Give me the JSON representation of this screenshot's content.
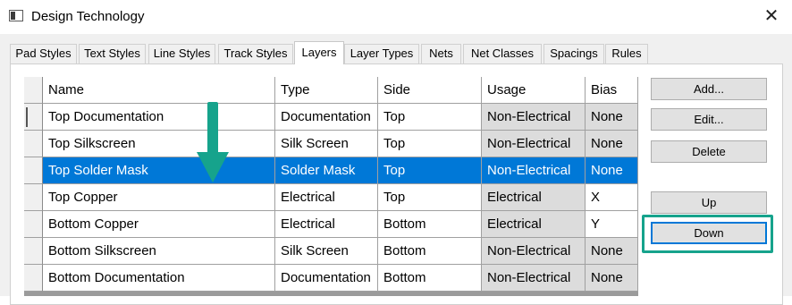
{
  "window": {
    "title": "Design Technology",
    "close_glyph": "✕"
  },
  "tabs": [
    {
      "label": "Pad Styles",
      "active": false
    },
    {
      "label": "Text Styles",
      "active": false
    },
    {
      "label": "Line Styles",
      "active": false
    },
    {
      "label": "Track Styles",
      "active": false
    },
    {
      "label": "Layers",
      "active": true
    },
    {
      "label": "Layer Types",
      "active": false
    },
    {
      "label": "Nets",
      "active": false
    },
    {
      "label": "Net Classes",
      "active": false
    },
    {
      "label": "Spacings",
      "active": false
    },
    {
      "label": "Rules",
      "active": false
    }
  ],
  "table": {
    "columns": [
      "Name",
      "Type",
      "Side",
      "Usage",
      "Bias"
    ],
    "rows": [
      {
        "name": "Top Documentation",
        "type": "Documentation",
        "side": "Top",
        "usage": "Non-Electrical",
        "bias": "None"
      },
      {
        "name": "Top Silkscreen",
        "type": "Silk Screen",
        "side": "Top",
        "usage": "Non-Electrical",
        "bias": "None"
      },
      {
        "name": "Top Solder Mask",
        "type": "Solder Mask",
        "side": "Top",
        "usage": "Non-Electrical",
        "bias": "None"
      },
      {
        "name": "Top Copper",
        "type": "Electrical",
        "side": "Top",
        "usage": "Electrical",
        "bias": "X"
      },
      {
        "name": "Bottom Copper",
        "type": "Electrical",
        "side": "Bottom",
        "usage": "Electrical",
        "bias": "Y"
      },
      {
        "name": "Bottom Silkscreen",
        "type": "Silk Screen",
        "side": "Bottom",
        "usage": "Non-Electrical",
        "bias": "None"
      },
      {
        "name": "Bottom Documentation",
        "type": "Documentation",
        "side": "Bottom",
        "usage": "Non-Electrical",
        "bias": "None"
      }
    ],
    "selected_row": 2
  },
  "buttons": {
    "add": "Add...",
    "edit": "Edit...",
    "delete": "Delete",
    "up": "Up",
    "down": "Down"
  },
  "colors": {
    "selection": "#0078d7",
    "annotation": "#16a38c"
  },
  "annotations": [
    {
      "icon": "down-arrow-icon"
    },
    {
      "icon": "highlight-box"
    }
  ]
}
